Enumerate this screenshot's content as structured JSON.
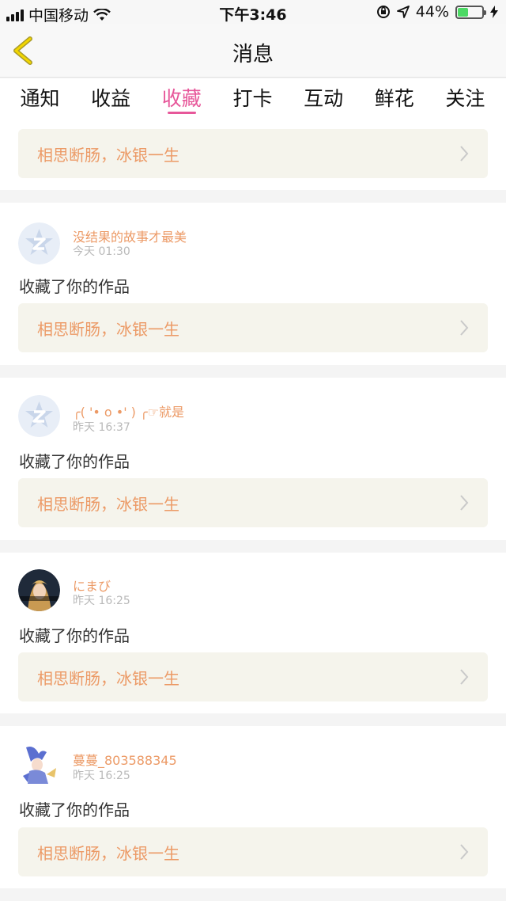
{
  "status_bar": {
    "carrier": "中国移动",
    "time": "下午3:46",
    "battery": "44%",
    "battery_level": 0.44
  },
  "nav": {
    "title": "消息"
  },
  "tabs": [
    {
      "label": "通知"
    },
    {
      "label": "收益"
    },
    {
      "label": "收藏",
      "active": true
    },
    {
      "label": "打卡"
    },
    {
      "label": "互动"
    },
    {
      "label": "鲜花"
    },
    {
      "label": "关注"
    }
  ],
  "top_card": {
    "work": "相思断肠，冰银一生"
  },
  "messages": [
    {
      "user": "没结果的故事才最美",
      "time": "今天 01:30",
      "action": "收藏了你的作品",
      "work": "相思断肠，冰银一生",
      "avatar": "default-avatar-icon"
    },
    {
      "user": "╭( '• o •' ) ╭☞就是",
      "time": "昨天 16:37",
      "action": "收藏了你的作品",
      "work": "相思断肠，冰银一生",
      "avatar": "default-avatar-icon"
    },
    {
      "user": "にまび",
      "time": "昨天 16:25",
      "action": "收藏了你的作品",
      "work": "相思断肠，冰银一生",
      "avatar": "photo-avatar-dark"
    },
    {
      "user": "蔓蔓_803588345",
      "time": "昨天 16:25",
      "action": "收藏了你的作品",
      "work": "相思断肠，冰银一生",
      "avatar": "photo-avatar-anime"
    }
  ],
  "colors": {
    "accent": "#e7579a",
    "username": "#ec9a66",
    "work_bg": "#f5f4ec"
  }
}
